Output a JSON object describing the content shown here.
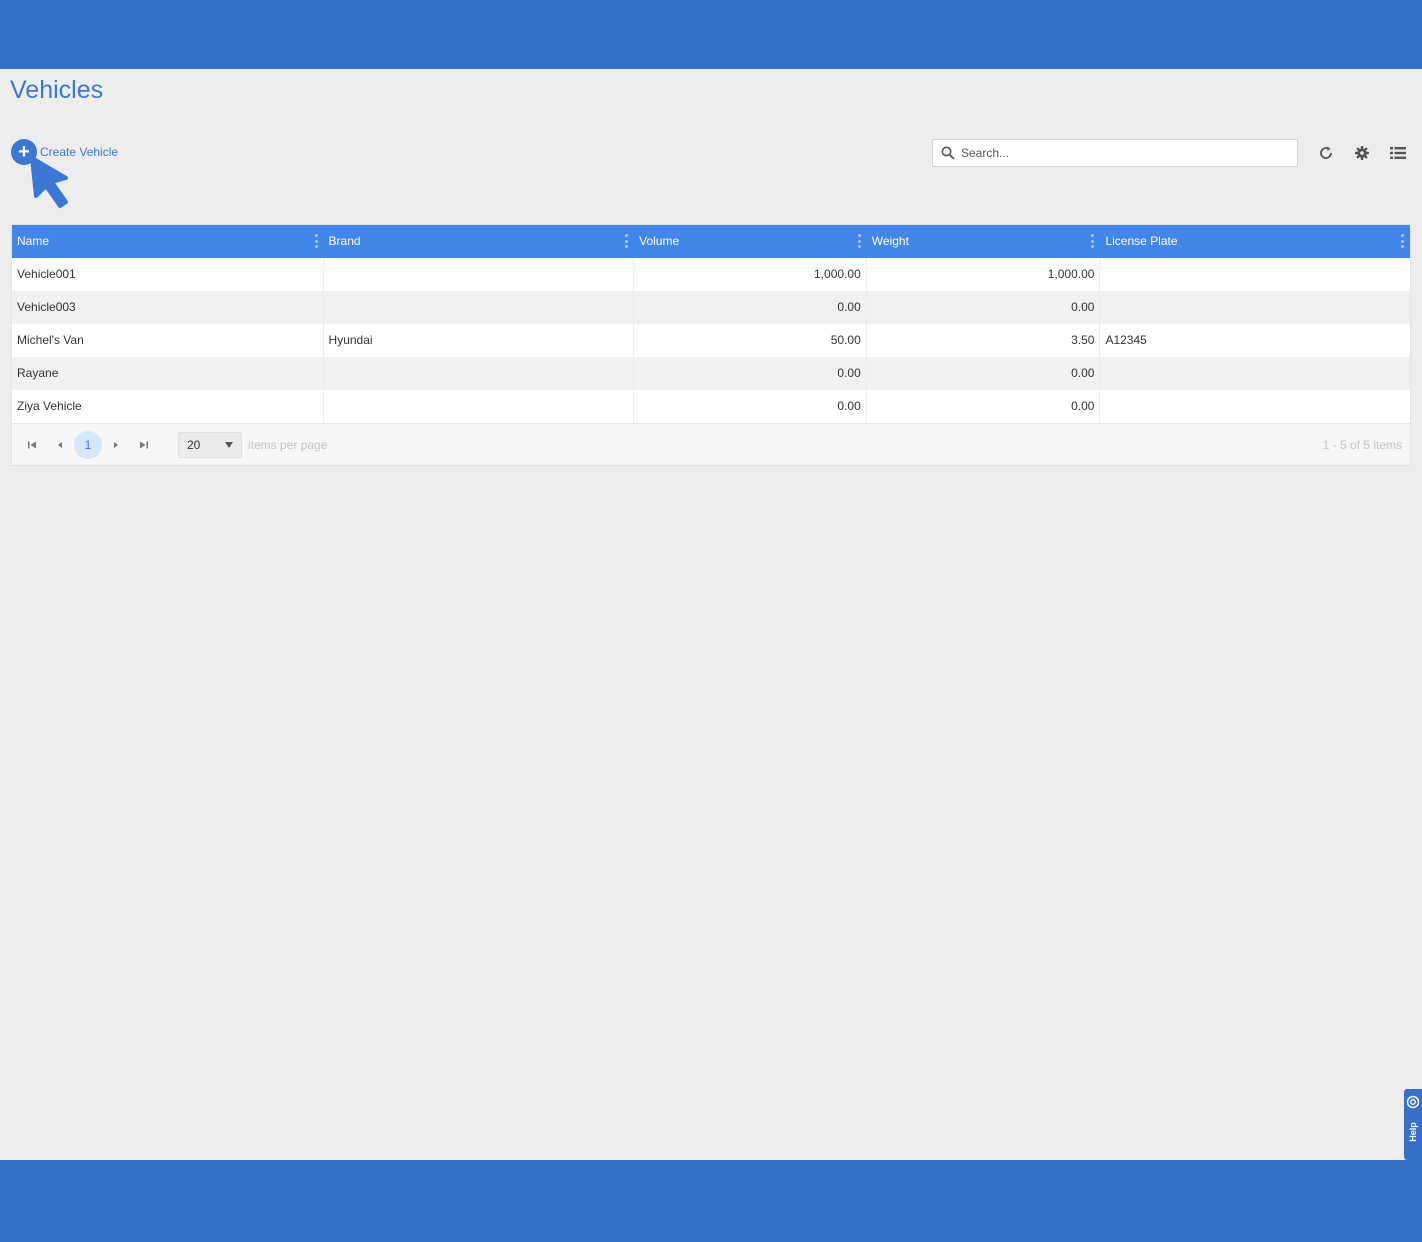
{
  "page": {
    "title": "Vehicles"
  },
  "toolbar": {
    "create_label": "Create Vehicle",
    "search_placeholder": "Search...",
    "icons": [
      "refresh-icon",
      "gear-icon",
      "list-view-icon"
    ]
  },
  "table": {
    "columns": [
      "Name",
      "Brand",
      "Volume",
      "Weight",
      "License Plate"
    ],
    "rows": [
      [
        "Vehicle001",
        "",
        "1,000.00",
        "1,000.00",
        ""
      ],
      [
        "Vehicle003",
        "",
        "0.00",
        "0.00",
        ""
      ],
      [
        "Michel's Van",
        "Hyundai",
        "50.00",
        "3.50",
        "A12345"
      ],
      [
        "Rayane",
        "",
        "0.00",
        "0.00",
        ""
      ],
      [
        "Ziya Vehicle",
        "",
        "0.00",
        "0.00",
        ""
      ]
    ]
  },
  "pager": {
    "current_page": "1",
    "page_size": "20",
    "per_page_label": "items per page",
    "summary": "1 - 5 of 5 items"
  },
  "help": {
    "label": "Help"
  },
  "colors": {
    "brand": "#3670c8",
    "header": "#4286e8",
    "accent": "#3b78d6"
  }
}
